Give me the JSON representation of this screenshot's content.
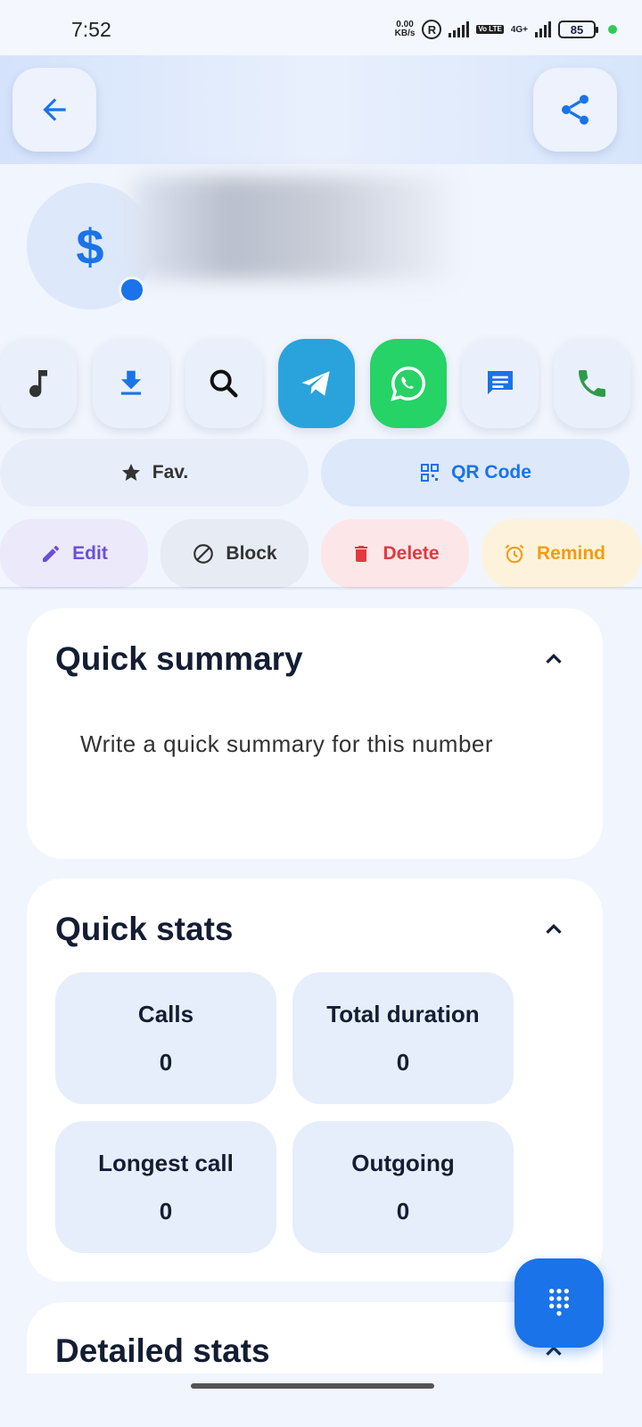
{
  "status_bar": {
    "time": "7:52",
    "net_speed_value": "0.00",
    "net_speed_unit": "KB/s",
    "registered": "R",
    "volte": "Vo LTE",
    "network": "4G+",
    "battery": "85"
  },
  "header": {
    "back_icon": "arrow-left-icon",
    "share_icon": "share-icon"
  },
  "profile": {
    "avatar_symbol": "$"
  },
  "actions": [
    {
      "name": "ringtone",
      "icon": "music-note-icon"
    },
    {
      "name": "download",
      "icon": "download-icon"
    },
    {
      "name": "search",
      "icon": "search-icon"
    },
    {
      "name": "telegram",
      "icon": "telegram-icon",
      "color": "#2aa3dc"
    },
    {
      "name": "whatsapp",
      "icon": "whatsapp-icon",
      "color": "#25d366"
    },
    {
      "name": "message",
      "icon": "message-icon"
    },
    {
      "name": "call",
      "icon": "phone-icon"
    }
  ],
  "buttons": {
    "fav": "Fav.",
    "qr_code": "QR Code",
    "edit": "Edit",
    "block": "Block",
    "delete": "Delete",
    "remind": "Remind"
  },
  "quick_summary": {
    "title": "Quick summary",
    "placeholder": "Write a quick summary for this number"
  },
  "quick_stats": {
    "title": "Quick stats",
    "items": [
      {
        "label": "Calls",
        "value": "0"
      },
      {
        "label": "Total duration",
        "value": "0"
      },
      {
        "label": "Longest call",
        "value": "0"
      },
      {
        "label": "Outgoing",
        "value": "0"
      }
    ]
  },
  "detailed_stats": {
    "title": "Detailed stats"
  },
  "colors": {
    "accent": "#1a73e8",
    "edit": "#6a4fd6",
    "delete": "#e0393e",
    "remind": "#f39c12"
  }
}
